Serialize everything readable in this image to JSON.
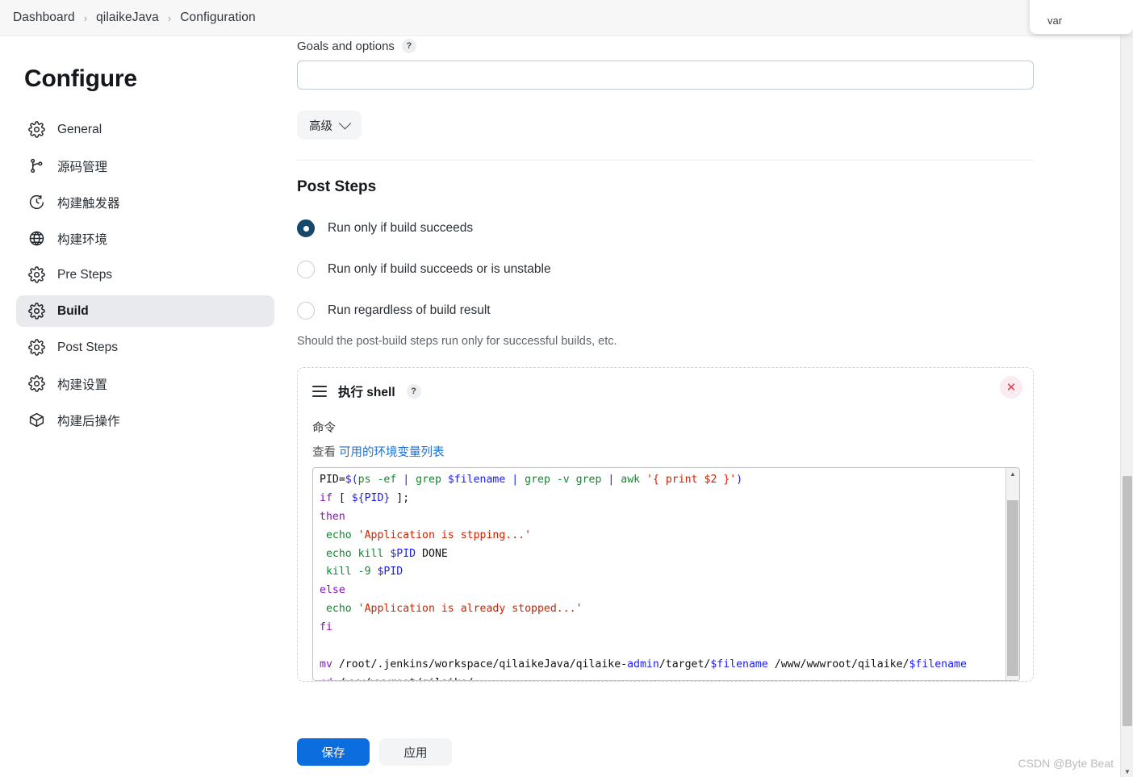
{
  "breadcrumb": {
    "items": [
      "Dashboard",
      "qilaikeJava",
      "Configuration"
    ],
    "separator": "›"
  },
  "sidebar": {
    "title": "Configure",
    "items": [
      {
        "label": "General",
        "icon": "gear-icon",
        "active": false
      },
      {
        "label": "源码管理",
        "icon": "branch-icon",
        "active": false
      },
      {
        "label": "构建触发器",
        "icon": "clock-icon",
        "active": false
      },
      {
        "label": "构建环境",
        "icon": "globe-icon",
        "active": false
      },
      {
        "label": "Pre Steps",
        "icon": "gear-icon",
        "active": false
      },
      {
        "label": "Build",
        "icon": "gear-icon",
        "active": true
      },
      {
        "label": "Post Steps",
        "icon": "gear-icon",
        "active": false
      },
      {
        "label": "构建设置",
        "icon": "gear-icon",
        "active": false
      },
      {
        "label": "构建后操作",
        "icon": "box-icon",
        "active": false
      }
    ]
  },
  "goals": {
    "label": "Goals and options",
    "help": "?",
    "value": "",
    "placeholder": ""
  },
  "advanced": {
    "label": "高级",
    "icon": "chevron-down-icon"
  },
  "post_steps": {
    "title": "Post Steps",
    "options": [
      {
        "label": "Run only if build succeeds",
        "checked": true
      },
      {
        "label": "Run only if build succeeds or is unstable",
        "checked": false
      },
      {
        "label": "Run regardless of build result",
        "checked": false
      }
    ],
    "hint": "Should the post-build steps run only for successful builds, etc."
  },
  "step_card": {
    "title": "执行 shell",
    "help": "?",
    "close_label": "✕",
    "command_label": "命令",
    "env_prefix": "查看",
    "env_link": "可用的环境变量列表",
    "code_lines": [
      [
        {
          "t": "PID=",
          "c": "plain"
        },
        {
          "t": "$(",
          "c": "var"
        },
        {
          "t": "ps",
          "c": "fn"
        },
        {
          "t": " -ef ",
          "c": "fn"
        },
        {
          "t": "| ",
          "c": "pipe"
        },
        {
          "t": "grep ",
          "c": "fn"
        },
        {
          "t": "$filename",
          "c": "var"
        },
        {
          "t": " ",
          "c": "plain"
        },
        {
          "t": "| ",
          "c": "pipe"
        },
        {
          "t": "grep ",
          "c": "fn"
        },
        {
          "t": "-v grep ",
          "c": "fn"
        },
        {
          "t": "| ",
          "c": "pipe"
        },
        {
          "t": "awk ",
          "c": "fn"
        },
        {
          "t": "'{ print $2 }'",
          "c": "str2"
        },
        {
          "t": ")",
          "c": "var"
        }
      ],
      [
        {
          "t": "if ",
          "c": "kw"
        },
        {
          "t": "[ ",
          "c": "plain"
        },
        {
          "t": "${PID}",
          "c": "var"
        },
        {
          "t": " ];",
          "c": "plain"
        }
      ],
      [
        {
          "t": "then",
          "c": "kw"
        }
      ],
      [
        {
          "t": " ",
          "c": "plain"
        },
        {
          "t": "echo ",
          "c": "fn"
        },
        {
          "t": "'Application is stpping...'",
          "c": "str"
        }
      ],
      [
        {
          "t": " ",
          "c": "plain"
        },
        {
          "t": "echo ",
          "c": "fn"
        },
        {
          "t": "kill ",
          "c": "fn"
        },
        {
          "t": "$PID",
          "c": "var"
        },
        {
          "t": " DONE",
          "c": "plain"
        }
      ],
      [
        {
          "t": " ",
          "c": "plain"
        },
        {
          "t": "kill ",
          "c": "fn"
        },
        {
          "t": "-9 ",
          "c": "fn"
        },
        {
          "t": "$PID",
          "c": "var"
        }
      ],
      [
        {
          "t": "else",
          "c": "kw"
        }
      ],
      [
        {
          "t": " ",
          "c": "plain"
        },
        {
          "t": "echo ",
          "c": "fn"
        },
        {
          "t": "'Application is already stopped...'",
          "c": "str"
        }
      ],
      [
        {
          "t": "fi",
          "c": "kw"
        }
      ],
      [
        {
          "t": "",
          "c": "plain"
        }
      ],
      [
        {
          "t": "mv ",
          "c": "cmd"
        },
        {
          "t": "/root/.jenkins/workspace/qilaikeJava/qilaike-",
          "c": "plain"
        },
        {
          "t": "admin",
          "c": "var"
        },
        {
          "t": "/target/",
          "c": "plain"
        },
        {
          "t": "$filename",
          "c": "var"
        },
        {
          "t": " /www/wwwroot/qilaike/",
          "c": "plain"
        },
        {
          "t": "$filename",
          "c": "var"
        }
      ],
      [
        {
          "t": "cd ",
          "c": "cmd"
        },
        {
          "t": "/www/wwwroot/qilaike/",
          "c": "plain"
        }
      ]
    ]
  },
  "footer": {
    "save_label": "保存",
    "apply_label": "应用"
  },
  "var_popup": {
    "text": "var"
  },
  "watermark": {
    "text": "CSDN @Byte Beat"
  },
  "scrollbar": {
    "down_arrow": "▼",
    "up_arrow": "▲"
  }
}
